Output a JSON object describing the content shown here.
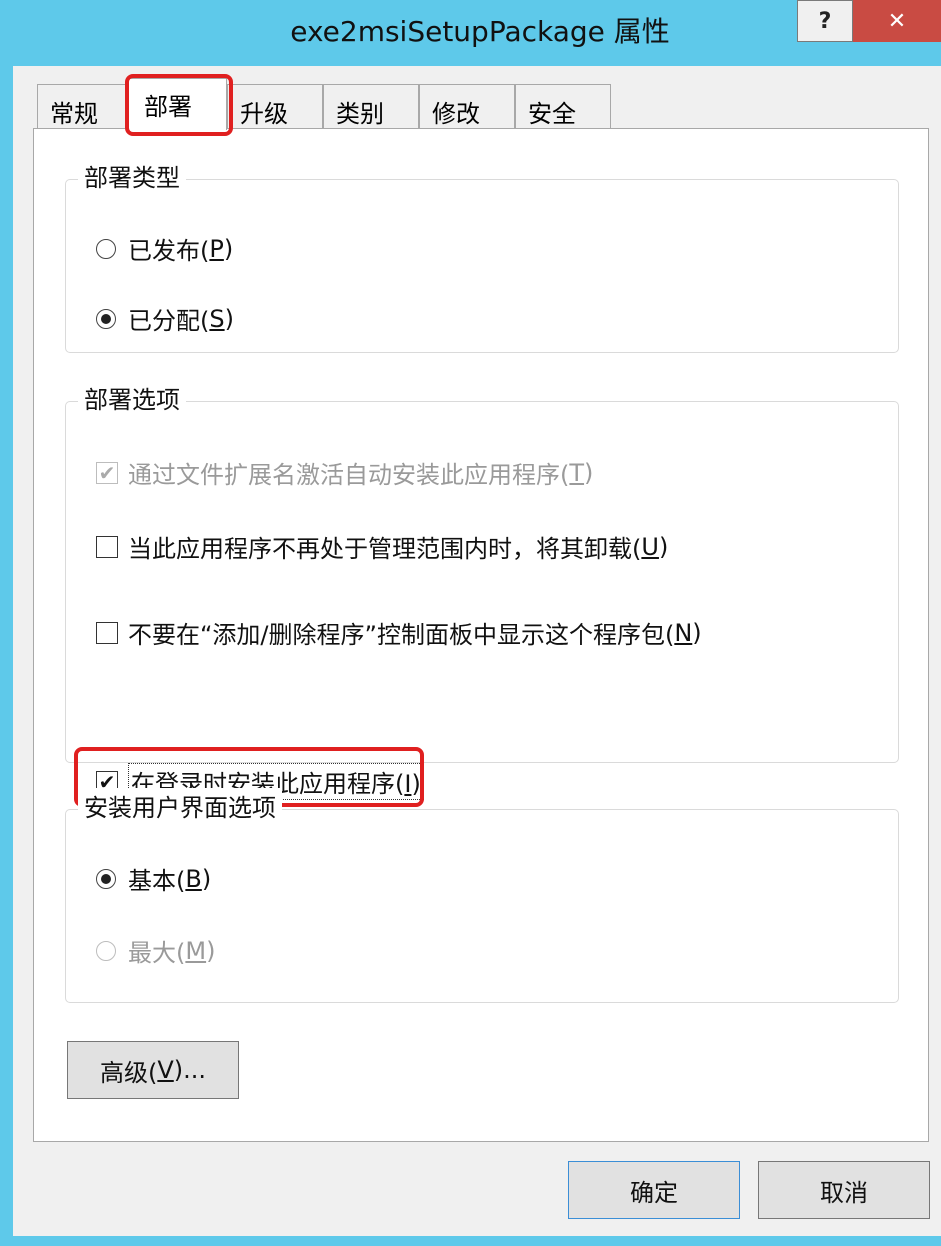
{
  "window": {
    "title": "exe2msiSetupPackage 属性",
    "help_label": "?",
    "close_label": "✕"
  },
  "tabs": [
    {
      "label": "常规",
      "selected": false
    },
    {
      "label": "部署",
      "selected": true
    },
    {
      "label": "升级",
      "selected": false
    },
    {
      "label": "类别",
      "selected": false
    },
    {
      "label": "修改",
      "selected": false
    },
    {
      "label": "安全",
      "selected": false
    }
  ],
  "deploy_type": {
    "legend": "部署类型",
    "published": {
      "label": "已发布(",
      "key": "P",
      "suffix": ")",
      "checked": false
    },
    "assigned": {
      "label": "已分配(",
      "key": "S",
      "suffix": ")",
      "checked": true
    }
  },
  "deploy_options": {
    "legend": "部署选项",
    "auto_install_ext": {
      "label": "通过文件扩展名激活自动安装此应用程序(",
      "key": "T",
      "suffix": ")",
      "checked": true,
      "disabled": true
    },
    "uninstall_outside": {
      "label": "当此应用程序不再处于管理范围内时，将其卸载(",
      "key": "U",
      "suffix": ")",
      "checked": false
    },
    "hide_in_arp": {
      "label": "不要在“添加/删除程序”控制面板中显示这个程序包(",
      "key": "N",
      "suffix": ")",
      "checked": false
    },
    "install_at_logon": {
      "label": "在登录时安装此应用程序(",
      "key": "I",
      "suffix": ")",
      "checked": true
    }
  },
  "ui_options": {
    "legend": "安装用户界面选项",
    "basic": {
      "label": "基本(",
      "key": "B",
      "suffix": ")",
      "checked": true
    },
    "maximum": {
      "label": "最大(",
      "key": "M",
      "suffix": ")",
      "checked": false,
      "disabled": true
    }
  },
  "buttons": {
    "advanced": {
      "label": "高级(",
      "key": "V",
      "suffix": ")..."
    },
    "ok": "确定",
    "cancel": "取消"
  },
  "colors": {
    "highlight": "#e02020",
    "titlebar": "#5ec9ea",
    "close": "#c94b43"
  }
}
